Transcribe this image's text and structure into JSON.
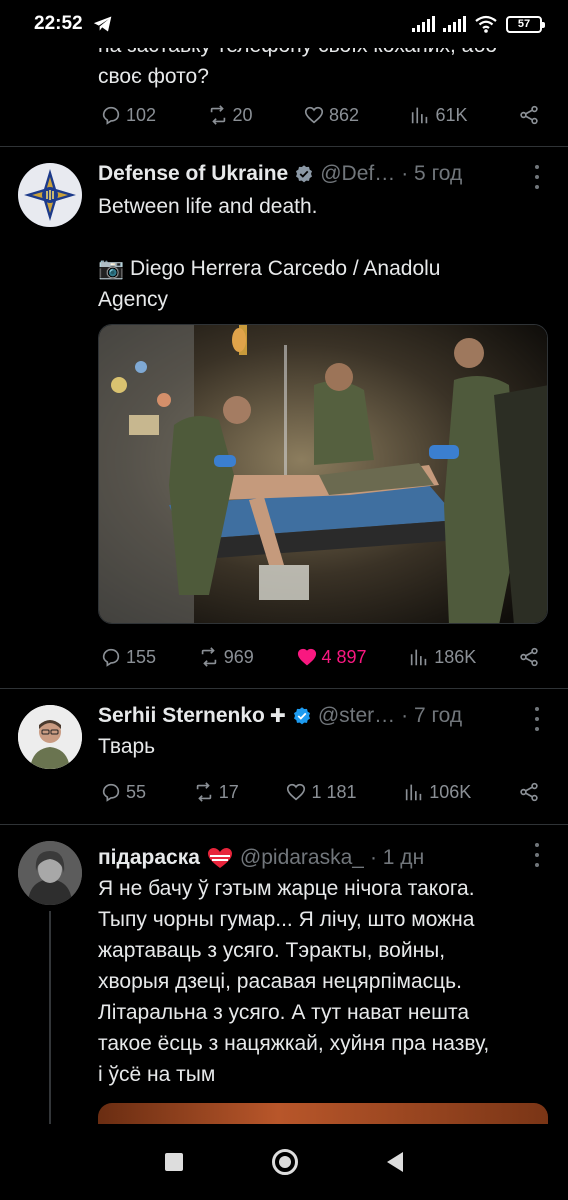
{
  "status_bar": {
    "time": "22:52",
    "battery": "57"
  },
  "tweet0": {
    "text_partial": "на заставку телефону своїх коханих, або\nсвоє фото?",
    "replies": "102",
    "retweets": "20",
    "likes": "862",
    "views": "61K"
  },
  "tweet1": {
    "name": "Defense of Ukraine",
    "handle": "@Def…",
    "time": "· 5 год",
    "text": "Between life and death.\n\n📷 Diego Herrera Carcedo / Anadolu\nAgency",
    "image_alt": "Field hospital: soldiers treating wounded man on table",
    "replies": "155",
    "retweets": "969",
    "likes": "4 897",
    "views": "186K"
  },
  "tweet2": {
    "name": "Serhii Sternenko",
    "name_suffix": "✚",
    "handle": "@ster…",
    "time": "· 7 год",
    "text": "Тварь",
    "replies": "55",
    "retweets": "17",
    "likes": "1 181",
    "views": "106K"
  },
  "tweet3": {
    "name": "підараска",
    "handle": "@pidaraska_",
    "time": "· 1 дн",
    "text": "Я не бачу ў гэтым жарце нічога такога.\nТыпу чорны гумар... Я лічу, што можна\nжартаваць з усяго. Тэракты, войны,\nхворыя дзеці, расавая нецярпімасць.\nЛітаральна з усяго. А тут нават нешта\nтакое ёсць з нацяжкай, хуйня пра назву,\nі ўсё на тым"
  },
  "colors": {
    "like": "#f91880",
    "verified": "#1d9bf0",
    "muted": "#71767b"
  }
}
